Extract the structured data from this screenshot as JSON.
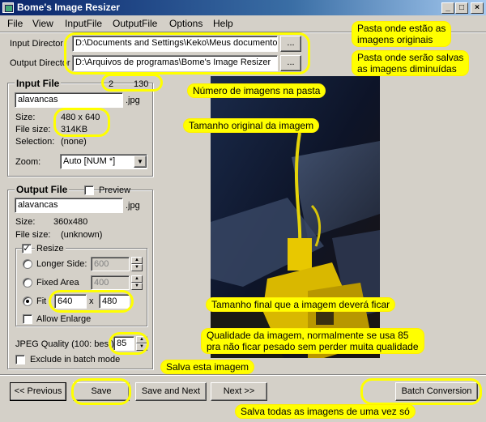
{
  "window": {
    "title": "Bome's Image Resizer",
    "minimize_glyph": "_",
    "maximize_glyph": "□",
    "close_glyph": "×"
  },
  "menu": [
    "File",
    "View",
    "InputFile",
    "OutputFile",
    "Options",
    "Help"
  ],
  "dirs": {
    "input_label": "Input Director",
    "input_value": "D:\\Documents and Settings\\Keko\\Meus documentos\\",
    "output_label": "Output Director",
    "output_value": "D:\\Arquivos de programas\\Bome's Image Resizer",
    "browse_label": "..."
  },
  "input_file": {
    "title": "Input File",
    "index": "2",
    "total": "130",
    "name": "alavancas",
    "ext": ".jpg",
    "size_label": "Size:",
    "size_value": "480 x 640",
    "filesize_label": "File size:",
    "filesize_value": "314KB",
    "selection_label": "Selection:",
    "selection_value": "(none)",
    "zoom_label": "Zoom:",
    "zoom_value": "Auto [NUM *]",
    "zoom_arrow": "▼"
  },
  "output_file": {
    "title": "Output File",
    "preview_label": "Preview",
    "name": "alavancas",
    "ext": ".jpg",
    "size_label": "Size:",
    "size_value": "360x480",
    "filesize_label": "File size:",
    "filesize_value": "(unknown)",
    "resize_label": "Resize",
    "resize_check": "✓",
    "longer_side_label": "Longer Side:",
    "longer_side_value": "600",
    "fixed_area_label": "Fixed Area",
    "fixed_area_value": "400",
    "fit_label": "Fit",
    "fit_w": "640",
    "fit_sep": "x",
    "fit_h": "480",
    "allow_enlarge_label": "Allow Enlarge",
    "jpeg_quality_label": "JPEG Quality (100: best)",
    "jpeg_quality_value": "85",
    "exclude_label": "Exclude in batch mode"
  },
  "buttons": {
    "previous": "<< Previous",
    "save": "Save",
    "save_next": "Save and Next",
    "next": "Next >>",
    "batch": "Batch Conversion",
    "spin_up": "▲",
    "spin_down": "▼"
  },
  "annotations": {
    "original_images": [
      "Pasta onde estão as",
      "imagens originais"
    ],
    "resized_images": [
      "Pasta onde serão salvas",
      "as imagens diminuídas"
    ],
    "image_count": "Número de imagens na pasta",
    "original_size": "Tamanho original da imagem",
    "final_size": "Tamanho final que a imagem deverá ficar",
    "quality": [
      "Qualidade da imagem, normalmente se usa 85",
      "pra não ficar pesado sem perder muita qualidade"
    ],
    "save_this": "Salva esta imagem",
    "save_all": "Salva todas as imagens de uma vez só"
  },
  "colors": {
    "titlebar_start": "#0a246a",
    "titlebar_end": "#a6caf0",
    "face": "#d4d0c8",
    "annotation": "#ffff00"
  }
}
